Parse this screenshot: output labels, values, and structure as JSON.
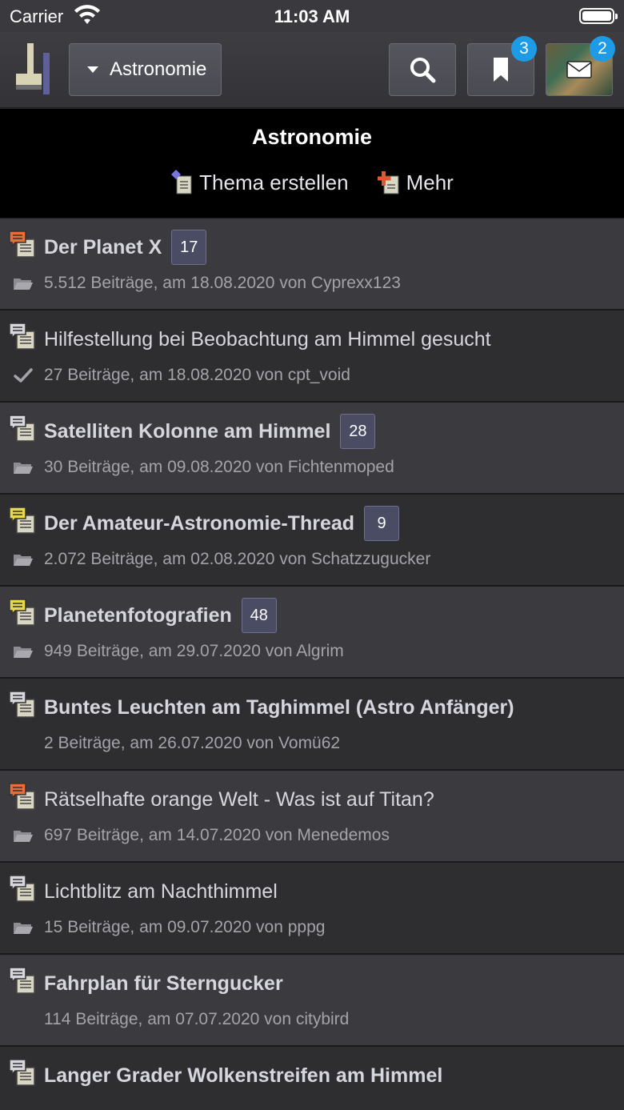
{
  "status_bar": {
    "carrier": "Carrier",
    "time": "11:03 AM"
  },
  "nav": {
    "forum_label": "Astronomie",
    "bookmark_badge": "3",
    "messages_badge": "2"
  },
  "header": {
    "title": "Astronomie",
    "create_topic": "Thema erstellen",
    "more": "Mehr"
  },
  "colors": {
    "accent_badge": "#1e9be6",
    "bubble_orange": "#e86d3c",
    "bubble_yellow": "#e6d94a",
    "bubble_grey": "#d7d7dd"
  },
  "threads": [
    {
      "title": "Der Planet X",
      "bold": true,
      "count": "17",
      "meta": "5.512 Beiträge, am 18.08.2020 von Cyprexx123",
      "bubble": "orange",
      "meta_icon": "folder-icon"
    },
    {
      "title": "Hilfestellung bei Beobachtung am Himmel gesucht",
      "bold": false,
      "count": "",
      "meta": "27 Beiträge, am 18.08.2020 von cpt_void",
      "bubble": "grey",
      "meta_icon": "checkmark-icon"
    },
    {
      "title": "Satelliten Kolonne am Himmel",
      "bold": true,
      "count": "28",
      "meta": "30 Beiträge, am 09.08.2020 von Fichtenmoped",
      "bubble": "grey",
      "meta_icon": "folder-icon"
    },
    {
      "title": "Der Amateur-Astronomie-Thread",
      "bold": true,
      "count": "9",
      "meta": "2.072 Beiträge, am 02.08.2020 von Schatzzugucker",
      "bubble": "yellow",
      "meta_icon": "folder-icon"
    },
    {
      "title": "Planetenfotografien",
      "bold": true,
      "count": "48",
      "meta": "949 Beiträge, am 29.07.2020 von Algrim",
      "bubble": "yellow",
      "meta_icon": "folder-icon"
    },
    {
      "title": "Buntes Leuchten am Taghimmel (Astro Anfänger)",
      "bold": true,
      "count": "",
      "meta": "2 Beiträge, am 26.07.2020 von Vomü62",
      "bubble": "grey",
      "meta_icon": ""
    },
    {
      "title": "Rätselhafte orange Welt - Was ist auf Titan?",
      "bold": false,
      "count": "",
      "meta": "697 Beiträge, am 14.07.2020 von Menedemos",
      "bubble": "orange",
      "meta_icon": "folder-icon"
    },
    {
      "title": "Lichtblitz am Nachthimmel",
      "bold": false,
      "count": "",
      "meta": "15 Beiträge, am 09.07.2020 von pppg",
      "bubble": "grey",
      "meta_icon": "folder-icon"
    },
    {
      "title": "Fahrplan für Sterngucker",
      "bold": true,
      "count": "",
      "meta": "114 Beiträge, am 07.07.2020 von citybird",
      "bubble": "grey",
      "meta_icon": ""
    },
    {
      "title": "Langer Grader Wolkenstreifen am Himmel",
      "bold": true,
      "count": "",
      "meta": "",
      "bubble": "grey",
      "meta_icon": ""
    }
  ]
}
